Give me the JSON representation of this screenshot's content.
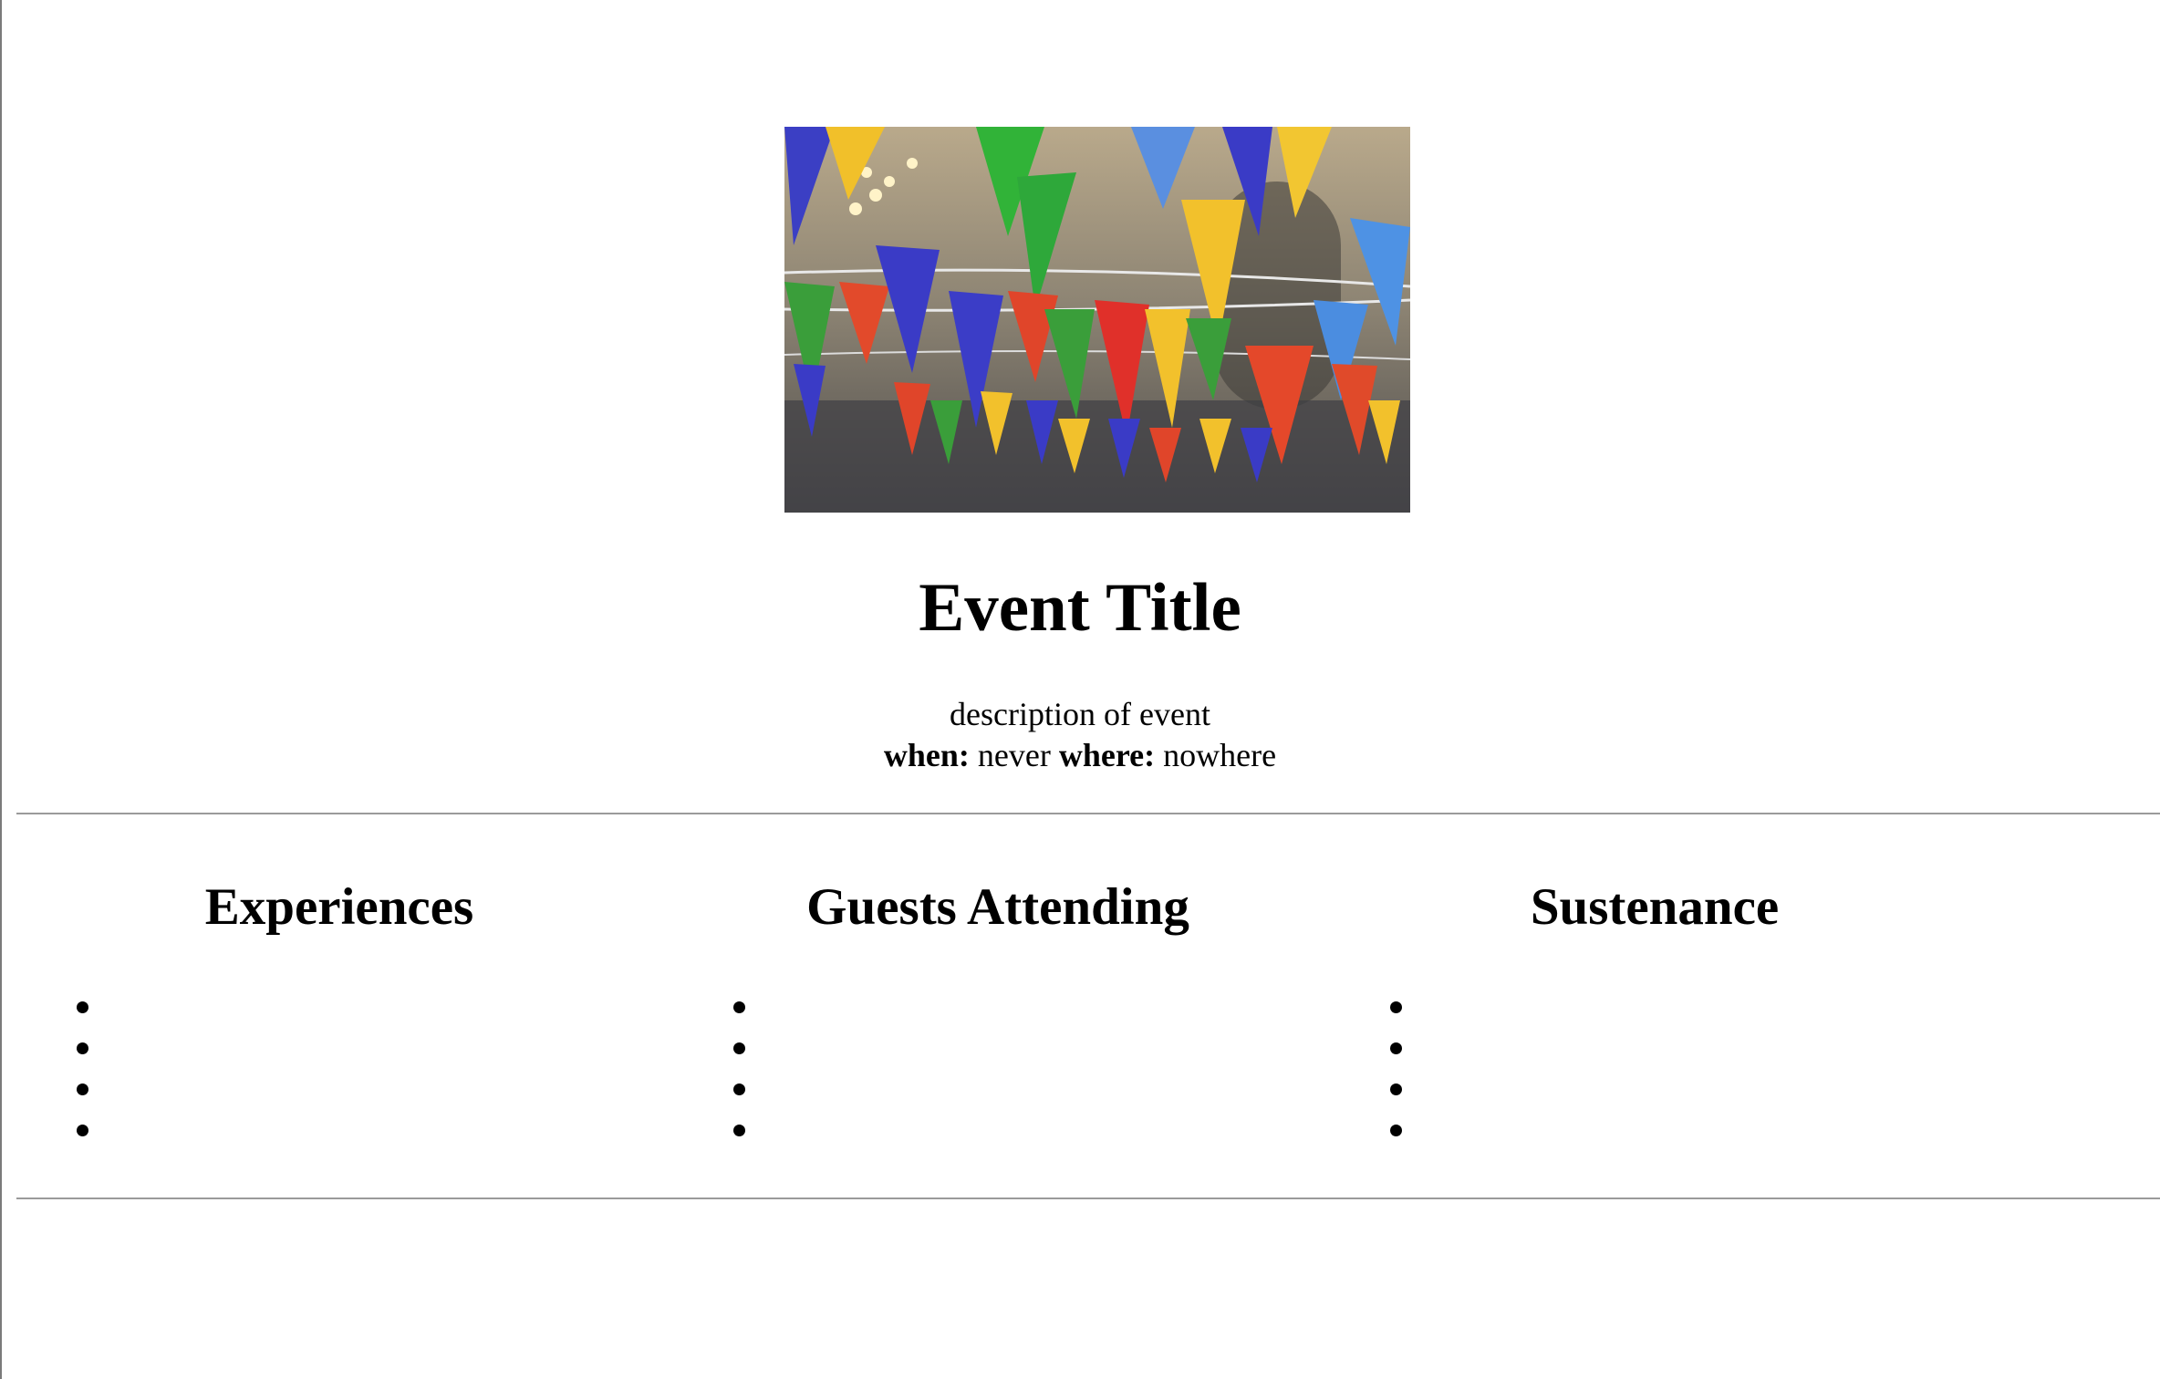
{
  "event": {
    "image_icon": "bunting-flags-image",
    "title": "Event Title",
    "description": "description of event",
    "when_label": "when:",
    "when_value": "never",
    "where_label": "where:",
    "where_value": "nowhere"
  },
  "columns": [
    {
      "heading": "Experiences",
      "items": [
        "",
        "",
        "",
        ""
      ]
    },
    {
      "heading": "Guests Attending",
      "items": [
        "",
        "",
        "",
        ""
      ]
    },
    {
      "heading": "Sustenance",
      "items": [
        "",
        "",
        "",
        ""
      ]
    }
  ]
}
